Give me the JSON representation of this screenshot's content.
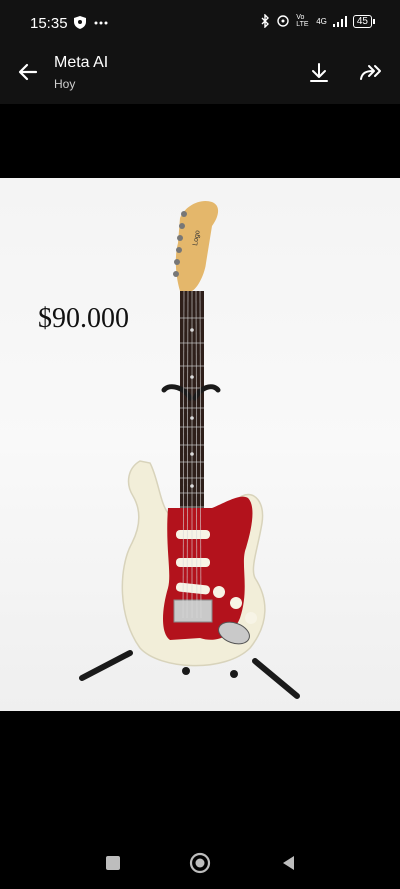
{
  "status": {
    "time": "15:35",
    "network": "4G",
    "volte": "Vo LTE",
    "battery": "45"
  },
  "header": {
    "title": "Meta AI",
    "subtitle": "Hoy"
  },
  "image": {
    "price_text": "$90.000"
  },
  "icons": {
    "back": "arrow-left-icon",
    "download": "download-icon",
    "forward": "forward-icon",
    "shield": "shield-icon",
    "more": "more-dots-icon",
    "bluetooth": "bluetooth-icon",
    "signal": "signal-icon",
    "recents": "square-icon",
    "home": "circle-icon",
    "nav_back": "triangle-back-icon"
  },
  "colors": {
    "bar_bg": "#121212",
    "guitar_body": "#f2eed9",
    "pickguard": "#b3121c"
  }
}
